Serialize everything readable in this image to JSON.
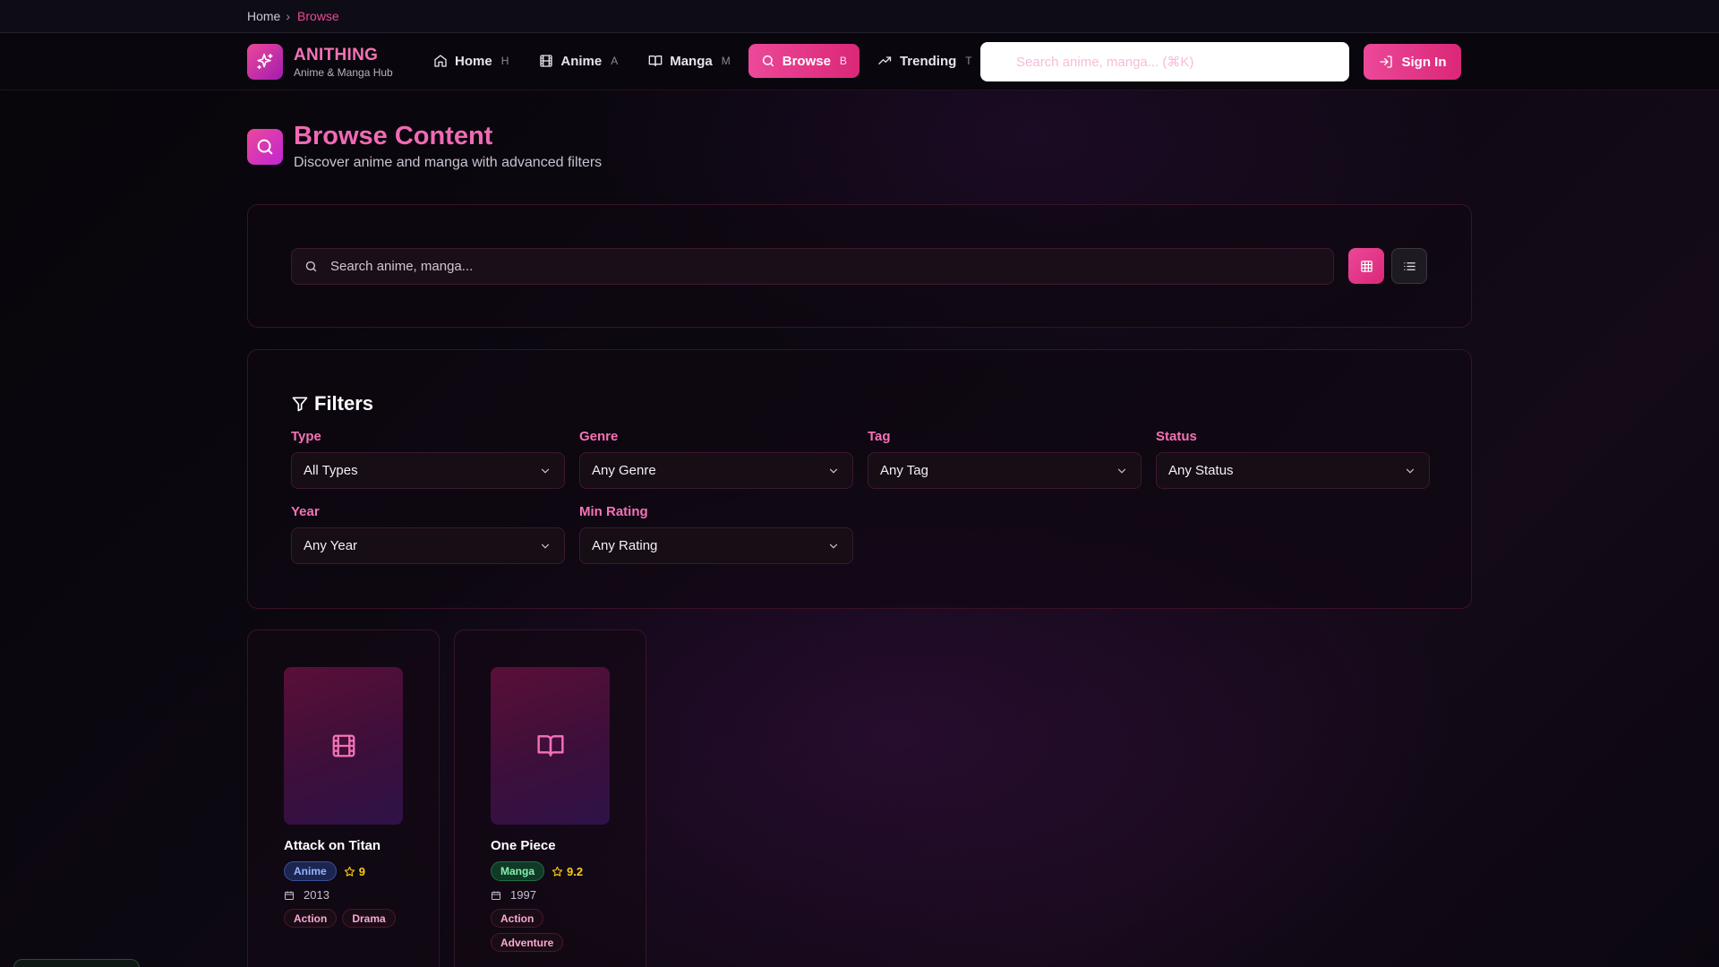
{
  "breadcrumb": {
    "home": "Home",
    "current": "Browse"
  },
  "brand": {
    "name": "ANITHING",
    "tagline": "Anime & Manga Hub"
  },
  "nav": [
    {
      "label": "Home",
      "key": "H",
      "icon": "home-icon"
    },
    {
      "label": "Anime",
      "key": "A",
      "icon": "film-icon"
    },
    {
      "label": "Manga",
      "key": "M",
      "icon": "book-icon"
    },
    {
      "label": "Browse",
      "key": "B",
      "icon": "search-icon",
      "active": true
    },
    {
      "label": "Trending",
      "key": "T",
      "icon": "trending-icon"
    }
  ],
  "header_search": {
    "placeholder": "Search anime, manga... (⌘K)"
  },
  "signin": {
    "label": "Sign In"
  },
  "page": {
    "title": "Browse Content",
    "subtitle": "Discover anime and manga with advanced filters"
  },
  "search": {
    "placeholder": "Search anime, manga..."
  },
  "filters": {
    "title": "Filters",
    "type": {
      "label": "Type",
      "value": "All Types"
    },
    "genre": {
      "label": "Genre",
      "value": "Any Genre"
    },
    "tag": {
      "label": "Tag",
      "value": "Any Tag"
    },
    "status": {
      "label": "Status",
      "value": "Any Status"
    },
    "year": {
      "label": "Year",
      "value": "Any Year"
    },
    "rating": {
      "label": "Min Rating",
      "value": "Any Rating"
    }
  },
  "results": [
    {
      "title": "Attack on Titan",
      "type": "Anime",
      "rating": "9",
      "year": "2013",
      "tags": [
        "Action",
        "Drama"
      ]
    },
    {
      "title": "One Piece",
      "type": "Manga",
      "rating": "9.2",
      "year": "1997",
      "tags": [
        "Action",
        "Adventure"
      ]
    }
  ],
  "colors": {
    "accent": "#ec4899",
    "background": "#0b0710",
    "anime_badge": "#93b4ff",
    "manga_badge": "#86efac",
    "rating": "#facc15"
  }
}
